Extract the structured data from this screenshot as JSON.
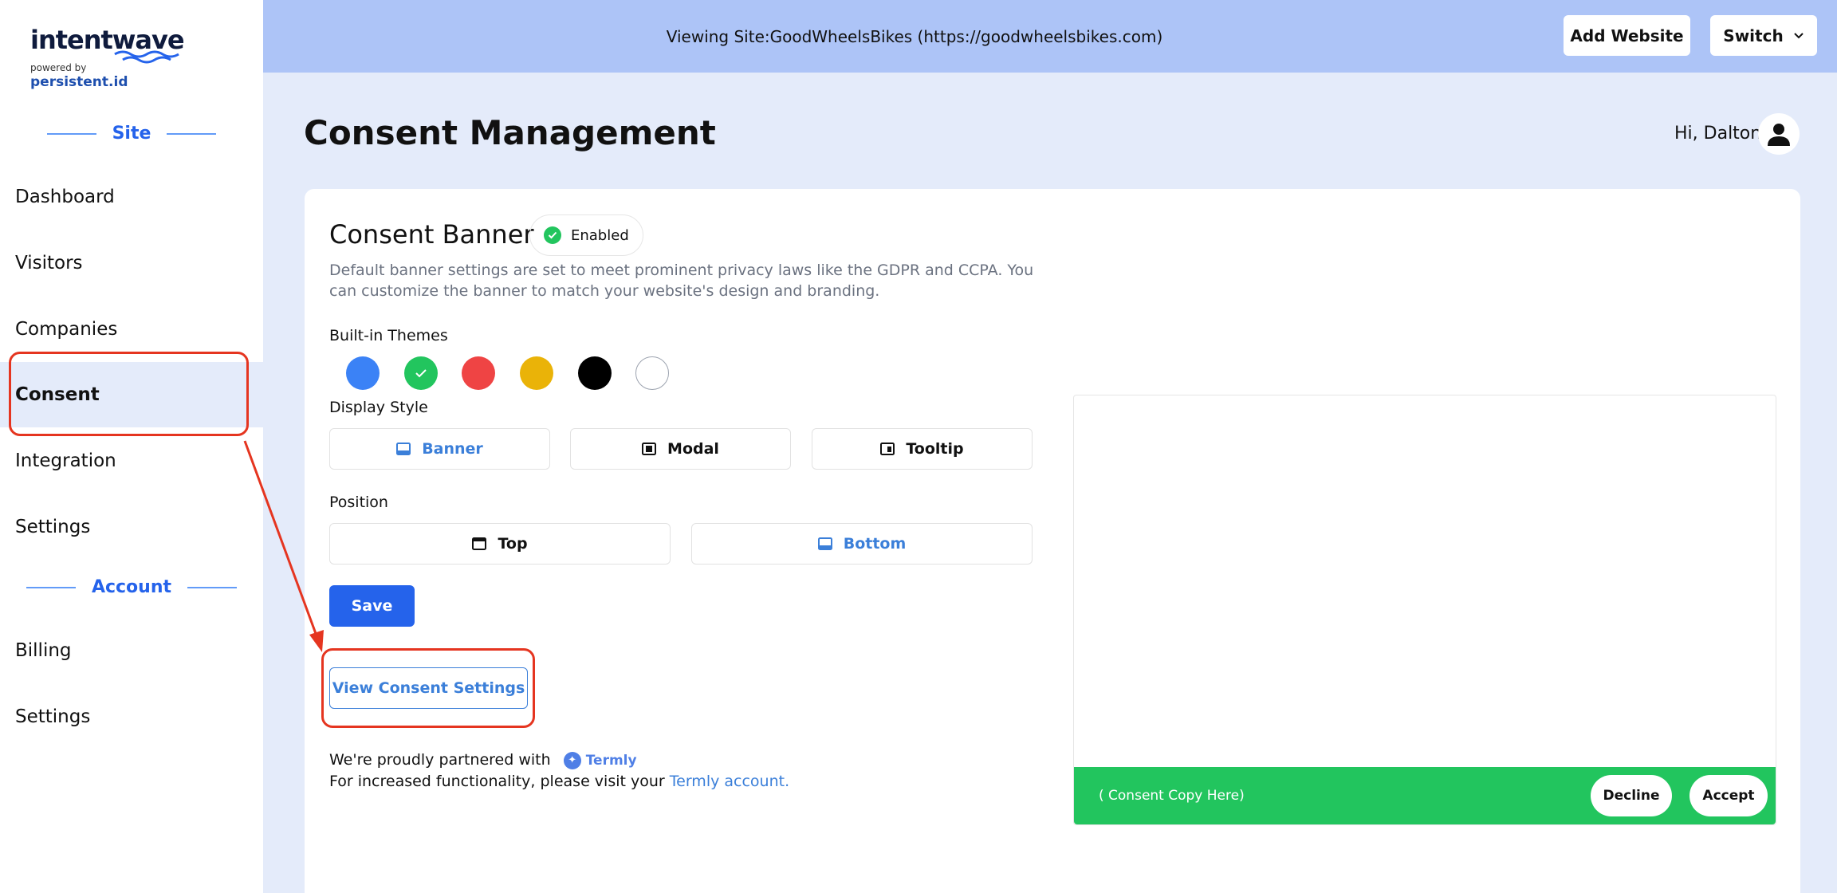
{
  "brand": {
    "name": "intentwave",
    "powered_by": "powered by",
    "partner_name": "persistent.id"
  },
  "sidebar": {
    "site_heading": "Site",
    "account_heading": "Account",
    "site_items": [
      {
        "label": "Dashboard"
      },
      {
        "label": "Visitors"
      },
      {
        "label": "Companies"
      },
      {
        "label": "Consent",
        "active": true
      },
      {
        "label": "Integration"
      },
      {
        "label": "Settings"
      }
    ],
    "account_items": [
      {
        "label": "Billing"
      },
      {
        "label": "Settings"
      }
    ]
  },
  "topbar": {
    "viewing_text": "Viewing Site:GoodWheelsBikes (https://goodwheelsbikes.com)",
    "add_website_label": "Add Website",
    "switch_label": "Switch"
  },
  "header": {
    "title": "Consent Management",
    "greeting": "Hi, Dalton"
  },
  "banner": {
    "title": "Consent Banner",
    "status": "Enabled",
    "description": "Default banner settings are set to meet prominent privacy laws like the GDPR and CCPA. You can customize the banner to match your website's design and branding.",
    "themes_label": "Built-in Themes",
    "themes": [
      {
        "name": "blue",
        "color": "#3b82f6",
        "selected": false
      },
      {
        "name": "green",
        "color": "#22c55e",
        "selected": true
      },
      {
        "name": "red",
        "color": "#ef4444",
        "selected": false
      },
      {
        "name": "yellow",
        "color": "#eab308",
        "selected": false
      },
      {
        "name": "black",
        "color": "#000000",
        "selected": false
      },
      {
        "name": "white",
        "color": "#ffffff",
        "selected": false
      }
    ],
    "display_style_label": "Display Style",
    "display_styles": [
      {
        "label": "Banner",
        "selected": true
      },
      {
        "label": "Modal",
        "selected": false
      },
      {
        "label": "Tooltip",
        "selected": false
      }
    ],
    "position_label": "Position",
    "positions": [
      {
        "label": "Top",
        "selected": false
      },
      {
        "label": "Bottom",
        "selected": true
      }
    ],
    "save_label": "Save",
    "view_consent_settings_label": "View Consent Settings",
    "partner_text": "We're proudly partnered with",
    "partner_brand": "Termly",
    "functionality_text": "For increased functionality, please visit your",
    "termly_link": "Termly account."
  },
  "preview": {
    "consent_copy": "( Consent Copy Here)",
    "decline_label": "Decline",
    "accept_label": "Accept",
    "bar_color": "#22c55e"
  },
  "colors": {
    "accent": "#2563eb",
    "annotation": "#e53520"
  }
}
